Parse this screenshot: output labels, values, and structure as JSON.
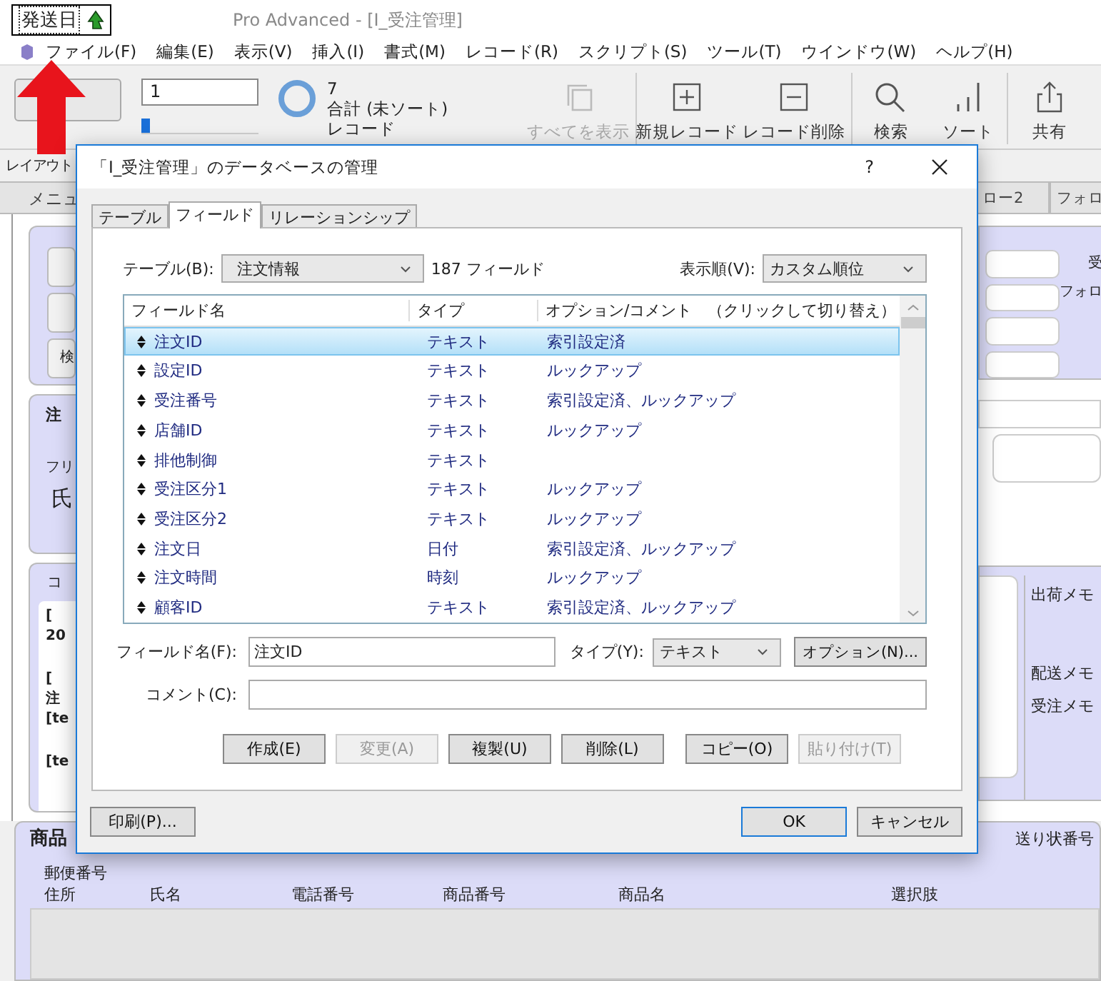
{
  "annotation": {
    "label": "発送日"
  },
  "window": {
    "title": "Pro Advanced - [I_受注管理]"
  },
  "menu": [
    "ファイル(F)",
    "編集(E)",
    "表示(V)",
    "挿入(I)",
    "書式(M)",
    "レコード(R)",
    "スクリプト(S)",
    "ツール(T)",
    "ウインドウ(W)",
    "ヘルプ(H)"
  ],
  "toolbar": {
    "record_number": "1",
    "record_slider": {
      "level": 0
    },
    "found_count": "7",
    "total_label": "合計 (未ソート)",
    "records_label": "レコード",
    "buttons": [
      {
        "kind": "show-all",
        "label": "すべてを表示",
        "disabled": true
      },
      {
        "kind": "new",
        "label": "新規レコード",
        "disabled": false
      },
      {
        "kind": "delete",
        "label": "レコード削除",
        "disabled": false
      },
      {
        "kind": "find",
        "label": "検索",
        "disabled": false
      },
      {
        "kind": "sort",
        "label": "ソート",
        "disabled": false
      },
      {
        "kind": "share",
        "label": "共有",
        "disabled": false
      }
    ]
  },
  "layout_bar": {
    "label": "レイアウト"
  },
  "layout_tabs": [
    "メニュ",
    "ロー2",
    "フォロ"
  ],
  "left_strip": {
    "button_label": "検",
    "order_header": "注",
    "furigana_label": "フリ",
    "name_label": "氏",
    "comment_header": "コ",
    "comment_paragraphs": [
      [
        "[",
        "20"
      ],
      [
        "[",
        "注",
        "[te"
      ],
      [
        "[te"
      ]
    ]
  },
  "right_strip": {
    "header_label": "受",
    "follow_label": "フォロ",
    "memo_labels": [
      "出荷メモ",
      "配送メモ",
      "受注メモ"
    ],
    "tracking_label": "送り状番号"
  },
  "products": {
    "header": "商品",
    "postal_label": "郵便番号",
    "columns": [
      "住所",
      "氏名",
      "電話番号",
      "商品番号",
      "商品名",
      "選択肢"
    ]
  },
  "dialog": {
    "title": "「I_受注管理」のデータベースの管理",
    "help": "?",
    "tabs": [
      {
        "label": "テーブル",
        "selected": false
      },
      {
        "label": "フィールド",
        "selected": true
      },
      {
        "label": "リレーションシップ",
        "selected": false
      }
    ],
    "table_label": "テーブル(B):",
    "table_value": "注文情報",
    "field_count": "187 フィールド",
    "order_label": "表示順(V):",
    "order_value": "カスタム順位",
    "columns": [
      "フィールド名",
      "タイプ",
      "オプション/コメント　（クリックして切り替え）"
    ],
    "fields": [
      {
        "name": "注文ID",
        "type": "テキスト",
        "options": "索引設定済",
        "selected": true
      },
      {
        "name": "設定ID",
        "type": "テキスト",
        "options": "ルックアップ",
        "selected": false
      },
      {
        "name": "受注番号",
        "type": "テキスト",
        "options": "索引設定済、ルックアップ",
        "selected": false
      },
      {
        "name": "店舗ID",
        "type": "テキスト",
        "options": "ルックアップ",
        "selected": false
      },
      {
        "name": "排他制御",
        "type": "テキスト",
        "selected": false
      },
      {
        "name": "受注区分1",
        "type": "テキスト",
        "options": "ルックアップ",
        "selected": false
      },
      {
        "name": "受注区分2",
        "type": "テキスト",
        "options": "ルックアップ",
        "selected": false
      },
      {
        "name": "注文日",
        "type": "日付",
        "options": "索引設定済、ルックアップ",
        "selected": false
      },
      {
        "name": "注文時間",
        "type": "時刻",
        "options": "ルックアップ",
        "selected": false
      },
      {
        "name": "顧客ID",
        "type": "テキスト",
        "options": "索引設定済、ルックアップ",
        "selected": false
      }
    ],
    "field_name_label": "フィールド名(F):",
    "field_name_value": "注文ID",
    "type_label": "タイプ(Y):",
    "type_value": "テキスト",
    "options_button": "オプション(N)...",
    "comment_label": "コメント(C):",
    "actions": [
      {
        "label": "作成(E)",
        "disabled": false
      },
      {
        "label": "変更(A)",
        "disabled": true
      },
      {
        "label": "複製(U)",
        "disabled": false
      },
      {
        "label": "削除(L)",
        "disabled": false
      },
      {
        "label": "コピー(O)",
        "disabled": false
      },
      {
        "label": "貼り付け(T)",
        "disabled": true
      }
    ],
    "print_button": "印刷(P)...",
    "ok_button": "OK",
    "cancel_button": "キャンセル"
  }
}
